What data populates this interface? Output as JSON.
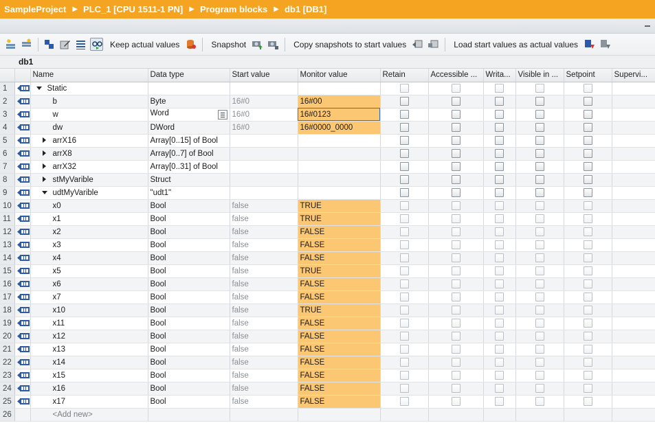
{
  "breadcrumb": [
    "SampleProject",
    "PLC_1 [CPU 1511-1 PN]",
    "Program blocks",
    "db1 [DB1]"
  ],
  "toolbar": {
    "keep_actual_values": "Keep actual values",
    "snapshot": "Snapshot",
    "copy_snapshots": "Copy snapshots to start values",
    "load_start_values": "Load start values as actual values"
  },
  "db_title": "db1",
  "columns": {
    "name": "Name",
    "data_type": "Data type",
    "start_value": "Start value",
    "monitor_value": "Monitor value",
    "retain": "Retain",
    "accessible": "Accessible ...",
    "writable": "Writa...",
    "visible": "Visible in ...",
    "setpoint": "Setpoint",
    "supervision": "Supervi..."
  },
  "rows": [
    {
      "num": "1",
      "name": "Static",
      "type": "",
      "start": "",
      "monitor": "",
      "expander": "down",
      "indent": 0,
      "dot": false
    },
    {
      "num": "2",
      "name": "b",
      "type": "Byte",
      "start": "16#0",
      "monitor": "16#00",
      "expander": "",
      "indent": 1,
      "dot": true
    },
    {
      "num": "3",
      "name": "w",
      "type": "Word",
      "start": "16#0",
      "monitor": "16#0123",
      "expander": "",
      "indent": 1,
      "dot": true
    },
    {
      "num": "4",
      "name": "dw",
      "type": "DWord",
      "start": "16#0",
      "monitor": "16#0000_0000",
      "expander": "",
      "indent": 1,
      "dot": true
    },
    {
      "num": "5",
      "name": "arrX16",
      "type": "Array[0..15] of Bool",
      "start": "",
      "monitor": "",
      "expander": "right",
      "indent": 1,
      "dot": true
    },
    {
      "num": "6",
      "name": "arrX8",
      "type": "Array[0..7] of Bool",
      "start": "",
      "monitor": "",
      "expander": "right",
      "indent": 1,
      "dot": true
    },
    {
      "num": "7",
      "name": "arrX32",
      "type": "Array[0..31] of Bool",
      "start": "",
      "monitor": "",
      "expander": "right",
      "indent": 1,
      "dot": true
    },
    {
      "num": "8",
      "name": "stMyVarible",
      "type": "Struct",
      "start": "",
      "monitor": "",
      "expander": "right",
      "indent": 1,
      "dot": true
    },
    {
      "num": "9",
      "name": "udtMyVarible",
      "type": "\"udt1\"",
      "start": "",
      "monitor": "",
      "expander": "down",
      "indent": 1,
      "dot": true
    },
    {
      "num": "10",
      "name": "x0",
      "type": "Bool",
      "start": "false",
      "monitor": "TRUE",
      "expander": "",
      "indent": 2,
      "dot": true
    },
    {
      "num": "11",
      "name": "x1",
      "type": "Bool",
      "start": "false",
      "monitor": "TRUE",
      "expander": "",
      "indent": 2,
      "dot": true
    },
    {
      "num": "12",
      "name": "x2",
      "type": "Bool",
      "start": "false",
      "monitor": "FALSE",
      "expander": "",
      "indent": 2,
      "dot": true
    },
    {
      "num": "13",
      "name": "x3",
      "type": "Bool",
      "start": "false",
      "monitor": "FALSE",
      "expander": "",
      "indent": 2,
      "dot": true
    },
    {
      "num": "14",
      "name": "x4",
      "type": "Bool",
      "start": "false",
      "monitor": "FALSE",
      "expander": "",
      "indent": 2,
      "dot": true
    },
    {
      "num": "15",
      "name": "x5",
      "type": "Bool",
      "start": "false",
      "monitor": "TRUE",
      "expander": "",
      "indent": 2,
      "dot": true
    },
    {
      "num": "16",
      "name": "x6",
      "type": "Bool",
      "start": "false",
      "monitor": "FALSE",
      "expander": "",
      "indent": 2,
      "dot": true
    },
    {
      "num": "17",
      "name": "x7",
      "type": "Bool",
      "start": "false",
      "monitor": "FALSE",
      "expander": "",
      "indent": 2,
      "dot": true
    },
    {
      "num": "18",
      "name": "x10",
      "type": "Bool",
      "start": "false",
      "monitor": "TRUE",
      "expander": "",
      "indent": 2,
      "dot": true
    },
    {
      "num": "19",
      "name": "x11",
      "type": "Bool",
      "start": "false",
      "monitor": "FALSE",
      "expander": "",
      "indent": 2,
      "dot": true
    },
    {
      "num": "20",
      "name": "x12",
      "type": "Bool",
      "start": "false",
      "monitor": "FALSE",
      "expander": "",
      "indent": 2,
      "dot": true
    },
    {
      "num": "21",
      "name": "x13",
      "type": "Bool",
      "start": "false",
      "monitor": "FALSE",
      "expander": "",
      "indent": 2,
      "dot": true
    },
    {
      "num": "22",
      "name": "x14",
      "type": "Bool",
      "start": "false",
      "monitor": "FALSE",
      "expander": "",
      "indent": 2,
      "dot": true
    },
    {
      "num": "23",
      "name": "x15",
      "type": "Bool",
      "start": "false",
      "monitor": "FALSE",
      "expander": "",
      "indent": 2,
      "dot": true
    },
    {
      "num": "24",
      "name": "x16",
      "type": "Bool",
      "start": "false",
      "monitor": "FALSE",
      "expander": "",
      "indent": 2,
      "dot": true
    },
    {
      "num": "25",
      "name": "x17",
      "type": "Bool",
      "start": "false",
      "monitor": "FALSE",
      "expander": "",
      "indent": 2,
      "dot": true
    },
    {
      "num": "26",
      "name": "<Add new>",
      "type": "",
      "start": "",
      "monitor": "",
      "expander": "",
      "indent": 1,
      "dot": true,
      "add_new": true
    }
  ],
  "colors": {
    "header_bar": "#f5a421",
    "monitor_cell": "#fcc773"
  }
}
